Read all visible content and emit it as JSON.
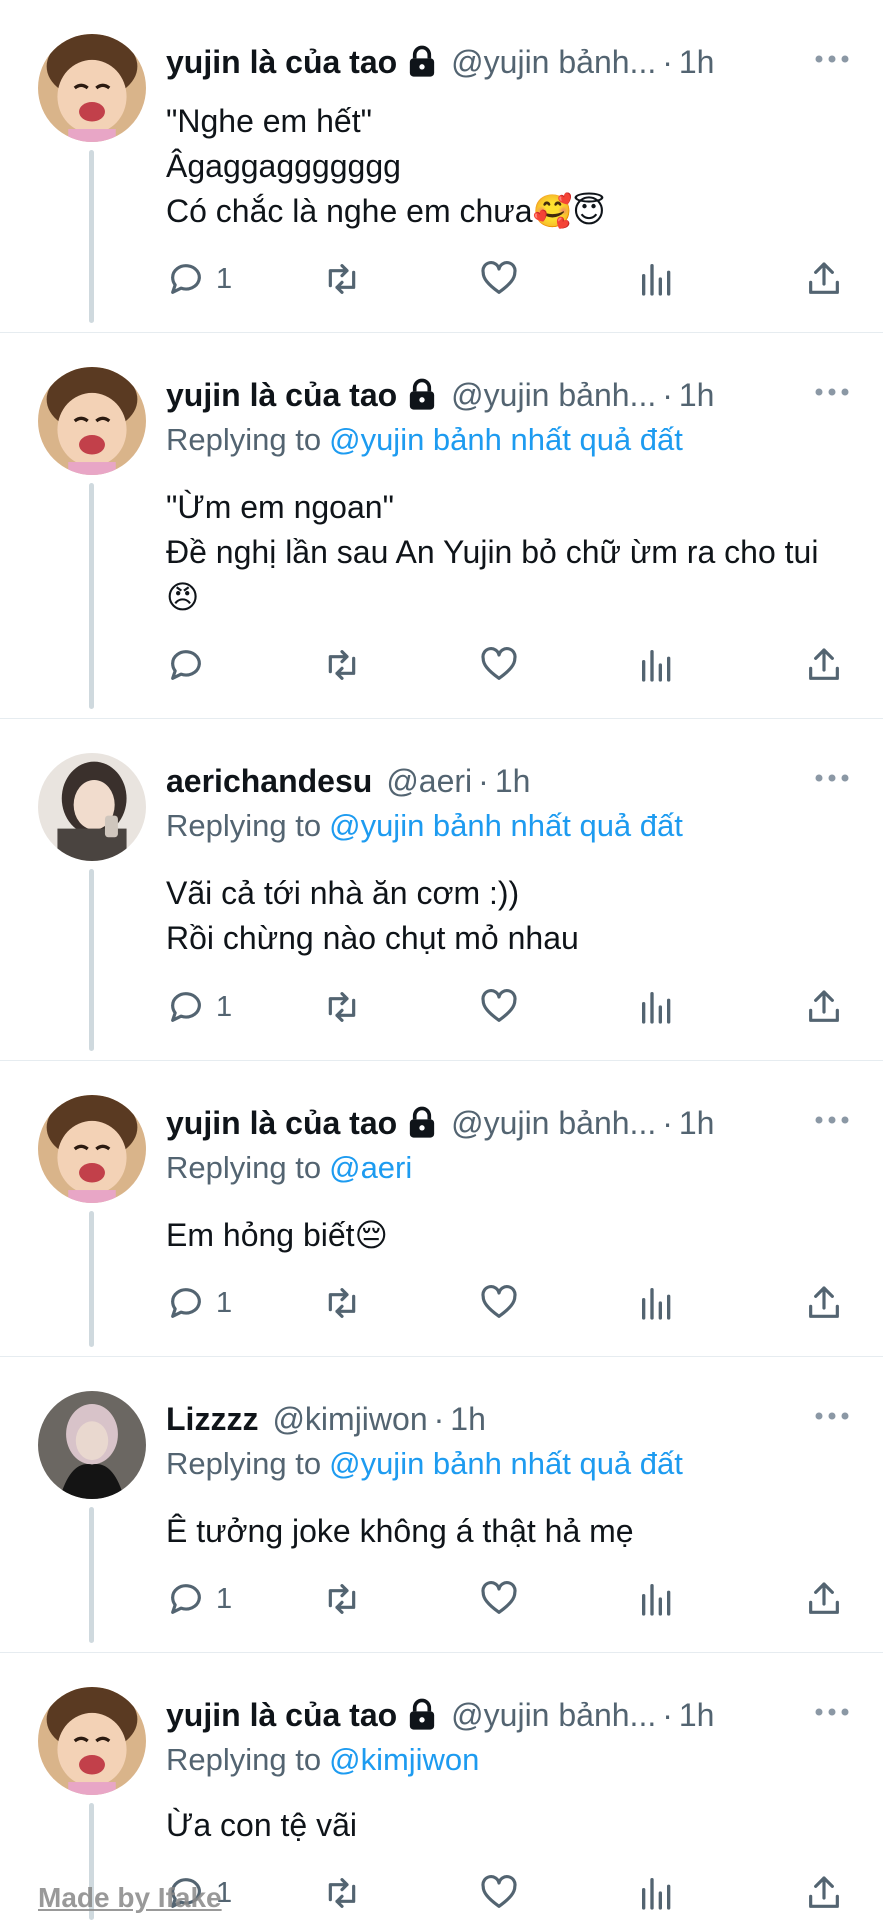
{
  "tweets": [
    {
      "display_name": "yujin là của tao",
      "handle": "@yujin bảnh...",
      "separator": "·",
      "time": "1h",
      "replying_label": "",
      "replying_to": "",
      "body": "\"Nghe em hết\"\nÂgaggaggggggg\nCó chắc là nghe em chưa🥰😇",
      "reply_count": "1",
      "avatar": "smiling-child"
    },
    {
      "display_name": "yujin là của tao",
      "handle": "@yujin bảnh...",
      "separator": "·",
      "time": "1h",
      "replying_label": "Replying to",
      "replying_to": "@yujin bảnh nhất quả đất",
      "body": "\"Ừm em ngoan\"\nĐề nghị lần sau An Yujin bỏ chữ ừm ra cho tui😠",
      "reply_count": "",
      "avatar": "smiling-child"
    },
    {
      "display_name": "aerichandesu",
      "handle": "@aeri",
      "separator": "·",
      "time": "1h",
      "replying_label": "Replying to",
      "replying_to": "@yujin bảnh nhất quả đất",
      "body": "Vãi cả tới nhà ăn cơm :))\nRồi chừng nào chụt mỏ nhau",
      "reply_count": "1",
      "avatar": "girl-selfie"
    },
    {
      "display_name": "yujin là của tao",
      "handle": "@yujin bảnh...",
      "separator": "·",
      "time": "1h",
      "replying_label": "Replying to",
      "replying_to": "@aeri",
      "body": "Em hỏng biết😔",
      "reply_count": "1",
      "avatar": "smiling-child"
    },
    {
      "display_name": "Lizzzz",
      "handle": "@kimjiwon",
      "separator": "·",
      "time": "1h",
      "replying_label": "Replying to",
      "replying_to": "@yujin bảnh nhất quả đất",
      "body": "Ê tưởng joke không á thật hả mẹ",
      "reply_count": "1",
      "avatar": "dark-portrait"
    },
    {
      "display_name": "yujin là của tao",
      "handle": "@yujin bảnh...",
      "separator": "·",
      "time": "1h",
      "replying_label": "Replying to",
      "replying_to": "@kimjiwon",
      "body": "Ừa con tệ vãi",
      "reply_count": "1",
      "avatar": "smiling-child"
    }
  ],
  "watermark": "Made by Ifake",
  "colors": {
    "text": "#0f1419",
    "secondary": "#536471",
    "link": "#1d9bf0",
    "divider": "#e6ecf0",
    "thread_line": "#cfd9de"
  }
}
